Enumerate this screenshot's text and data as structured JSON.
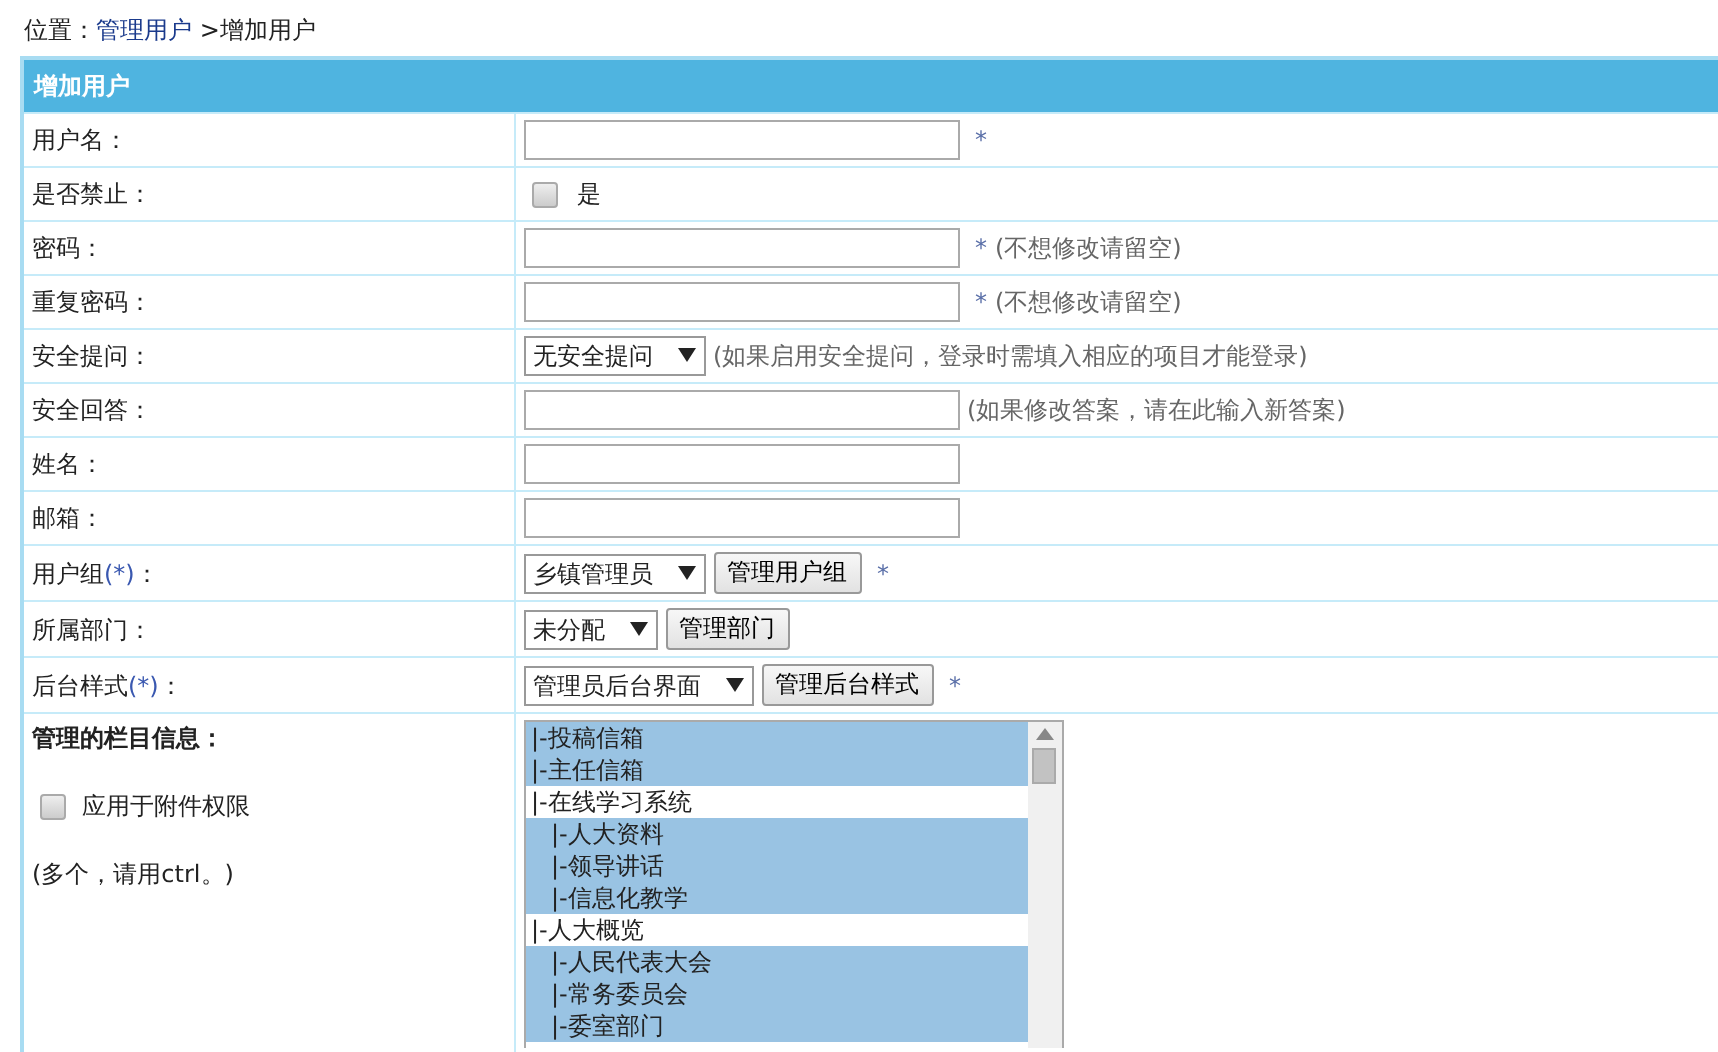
{
  "breadcrumb": {
    "prefix": "位置：",
    "link": "管理用户",
    "separator": ">",
    "current": "增加用户"
  },
  "form_title": "增加用户",
  "rows": [
    {
      "label": "用户名：",
      "controls": [
        {
          "kind": "input"
        }
      ],
      "star": "*"
    },
    {
      "label": "是否禁止：",
      "controls": [
        {
          "kind": "checkbox",
          "checked": false,
          "label": "是"
        }
      ]
    },
    {
      "label": "密码：",
      "controls": [
        {
          "kind": "input"
        }
      ],
      "star": "*",
      "hint": "(不想修改请留空)"
    },
    {
      "label": "重复密码：",
      "controls": [
        {
          "kind": "input"
        }
      ],
      "star": "*",
      "hint": "(不想修改请留空)"
    },
    {
      "label": "安全提问：",
      "controls": [
        {
          "kind": "select",
          "value": "无安全提问"
        }
      ],
      "hint": "(如果启用安全提问，登录时需填入相应的项目才能登录)"
    },
    {
      "label": "安全回答：",
      "controls": [
        {
          "kind": "input"
        }
      ],
      "hint": "(如果修改答案，请在此输入新答案)"
    },
    {
      "label": "姓名：",
      "controls": [
        {
          "kind": "input"
        }
      ]
    },
    {
      "label": "邮箱：",
      "controls": [
        {
          "kind": "input"
        }
      ]
    },
    {
      "label": "用户组",
      "label_mark": "(*)",
      "label_suffix": "：",
      "controls": [
        {
          "kind": "select",
          "value": "乡镇管理员"
        },
        {
          "kind": "button",
          "label": "管理用户组"
        }
      ],
      "star": "*"
    },
    {
      "label": "所属部门：",
      "controls": [
        {
          "kind": "select",
          "value": "未分配"
        },
        {
          "kind": "button",
          "label": "管理部门"
        }
      ]
    },
    {
      "label": "后台样式",
      "label_mark": "(*)",
      "label_suffix": "：",
      "controls": [
        {
          "kind": "select",
          "value": "管理员后台界面"
        },
        {
          "kind": "button",
          "label": "管理后台样式"
        }
      ],
      "star": "*"
    }
  ],
  "columns_section": {
    "title": "管理的栏目信息：",
    "attachment_checkbox": {
      "label": "应用于附件权限",
      "checked": false
    },
    "note": "(多个，请用ctrl。)",
    "items": [
      {
        "label": "|-投稿信箱",
        "selected": true
      },
      {
        "label": "|-主任信箱",
        "selected": true
      },
      {
        "label": "|-在线学习系统",
        "selected": false,
        "children": [
          {
            "label": "|-人大资料",
            "selected": true
          },
          {
            "label": "|-领导讲话",
            "selected": true
          },
          {
            "label": "|-信息化教学",
            "selected": true
          }
        ]
      },
      {
        "label": "|-人大概览",
        "selected": false,
        "children": [
          {
            "label": "|-人民代表大会",
            "selected": true
          },
          {
            "label": "|-常务委员会",
            "selected": true
          },
          {
            "label": "|-委室部门",
            "selected": true
          }
        ]
      }
    ]
  }
}
